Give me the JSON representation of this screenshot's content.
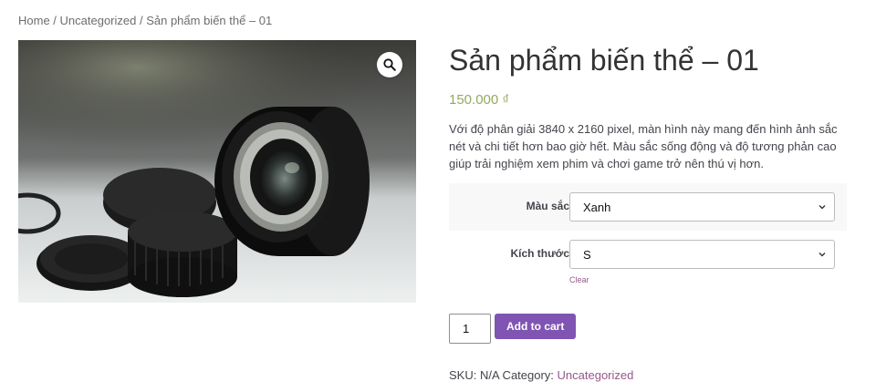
{
  "breadcrumb": {
    "home": "Home",
    "sep1": " / ",
    "category": "Uncategorized",
    "sep2": " / ",
    "current": "Sản phẩm biến thể – 01"
  },
  "gallery": {
    "image_alt": "Camera lens with lens caps",
    "zoom_icon": "magnifier-icon"
  },
  "product": {
    "title": "Sản phẩm biến thể – 01",
    "price": "150.000 ₫",
    "description": "Với độ phân giải 3840 x 2160 pixel, màn hình này mang đến hình ảnh sắc nét và chi tiết hơn bao giờ hết. Màu sắc sống động và độ tương phản cao giúp trải nghiệm xem phim và chơi game trở nên thú vị hơn."
  },
  "variations": {
    "color": {
      "label": "Màu sắc",
      "value": "Xanh"
    },
    "size": {
      "label": "Kích thước",
      "value": "S"
    },
    "clear_label": "Clear"
  },
  "cart": {
    "quantity": "1",
    "add_label": "Add to cart"
  },
  "meta": {
    "sku_label": "SKU: ",
    "sku_value": "N/A",
    "category_label": " Category: ",
    "category_value": "Uncategorized"
  },
  "colors": {
    "price": "#96a85f",
    "button": "#7f54b3",
    "link": "#96588a"
  }
}
